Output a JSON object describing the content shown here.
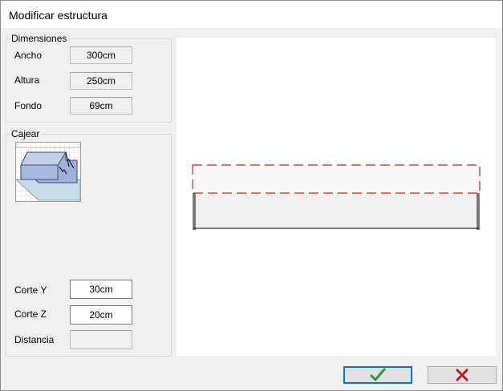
{
  "window": {
    "title": "Modificar estructura"
  },
  "dimensions": {
    "legend": "Dimensiones",
    "ancho": {
      "label": "Ancho",
      "value": "300cm"
    },
    "altura": {
      "label": "Altura",
      "value": "250cm"
    },
    "fondo": {
      "label": "Fondo",
      "value": "69cm"
    }
  },
  "cajear": {
    "legend": "Cajear",
    "corte_y": {
      "label": "Corte Y",
      "value": "30cm"
    },
    "corte_z": {
      "label": "Corte Z",
      "value": "20cm"
    },
    "distancia": {
      "label": "Distancia",
      "value": ""
    }
  },
  "buttons": {
    "ok_icon": "checkmark-icon",
    "cancel_icon": "x-icon"
  },
  "colors": {
    "ok_check": "#2e9a2e",
    "cancel_x": "#b02020",
    "dash": "#d02020",
    "accent": "#0078d7"
  }
}
